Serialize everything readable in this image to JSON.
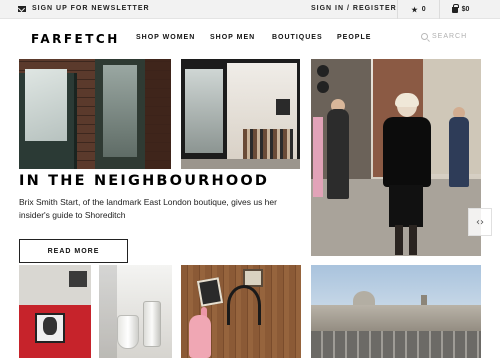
{
  "utility": {
    "newsletter_label": "SIGN UP FOR NEWSLETTER",
    "signin_label": "SIGN IN / REGISTER",
    "wishlist_count": "0",
    "bag_amount": "$0"
  },
  "header": {
    "logo": "FARFETCH",
    "nav": {
      "women": "SHOP WOMEN",
      "men": "SHOP MEN",
      "boutiques": "BOUTIQUES",
      "people": "PEOPLE"
    },
    "search_label": "SEARCH"
  },
  "feature": {
    "headline": "IN THE NEIGHBOURHOOD",
    "blurb": "Brix Smith Start, of the landmark East London boutique, gives us her insider's guide to Shoreditch",
    "read_more": "READ MORE",
    "carousel_arrow": "‹›"
  },
  "icons": {
    "newsletter": "envelope-icon",
    "wishlist": "star-icon",
    "bag": "shopping-bag-icon",
    "search": "search-icon",
    "carousel": "chevron-left-right-icon"
  }
}
